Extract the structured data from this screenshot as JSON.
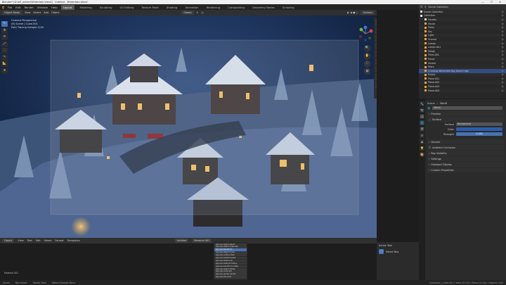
{
  "titlebar": {
    "text": "Blender* [D:\\b3_winter\\Wintertale.blend]  ·  Untitled - Wintertale.blend"
  },
  "menubar": {
    "logo": "⧉",
    "menus": [
      "File",
      "Edit",
      "Render",
      "Window",
      "Help"
    ],
    "workspaces": [
      "Layout",
      "Modeling",
      "Sculpting",
      "UV Editing",
      "Texture Paint",
      "Shading",
      "Animation",
      "Rendering",
      "Compositing",
      "Geometry Nodes",
      "Scripting"
    ],
    "active_workspace": "Layout",
    "scene_label": "Scene",
    "view_layer_label": "View Layer"
  },
  "viewport_header": {
    "mode": "Object Mode",
    "menus": [
      "View",
      "Select",
      "Add",
      "Object"
    ],
    "transform": "Global",
    "options": "Options"
  },
  "viewport_overlay": {
    "camera": "Camera Perspective",
    "scene_path": "(6) Scene | Cube.001",
    "samples": "Path Tracing Sample 2/16"
  },
  "toolbar": {
    "tools": [
      "↖",
      "✥",
      "⟳",
      "⤢",
      "⬚",
      "✎",
      "📐",
      "⊕"
    ]
  },
  "nav_buttons": [
    "🔍",
    "✋",
    "🎥",
    "▦"
  ],
  "outliner": {
    "header": "Scene Collection",
    "rows": [
      {
        "label": "Scene Collection",
        "color": "#e0e0e0",
        "selected": false
      },
      {
        "label": "Collection",
        "color": "#e0e0e0",
        "selected": false
      },
      {
        "label": "Houses",
        "color": "#e0e0e0",
        "selected": false
      },
      {
        "label": "House",
        "color": "#e9a23b",
        "selected": false
      },
      {
        "label": "Trees",
        "color": "#e9a23b",
        "selected": false
      },
      {
        "label": "Sky",
        "color": "#e9a23b",
        "selected": false
      },
      {
        "label": "Light",
        "color": "#e9a23b",
        "selected": false
      },
      {
        "label": "Ground",
        "color": "#e9a23b",
        "selected": false
      },
      {
        "label": "Lamps",
        "color": "#e9a23b",
        "selected": false
      },
      {
        "label": "Lamps.001",
        "color": "#e9a23b",
        "selected": false
      },
      {
        "label": "Sleigh",
        "color": "#e9a23b",
        "selected": false
      },
      {
        "label": "Trees.001",
        "color": "#e9a23b",
        "selected": false
      },
      {
        "label": "Fence",
        "color": "#e9a23b",
        "selected": false
      },
      {
        "label": "Smoke",
        "color": "#e9a23b",
        "selected": false
      },
      {
        "label": "Stars",
        "color": "#e9a23b",
        "selected": false
      },
      {
        "label": "Creating Wintertale Big Dome High",
        "color": "#e9a23b",
        "selected": true
      },
      {
        "label": "Empty",
        "color": "#e9a23b",
        "selected": false
      },
      {
        "label": "Plane.001",
        "color": "#e9a23b",
        "selected": false
      },
      {
        "label": "Plane.002",
        "color": "#e9a23b",
        "selected": false
      },
      {
        "label": "Plane.003",
        "color": "#e9a23b",
        "selected": false
      },
      {
        "label": "Plane.004",
        "color": "#e9a23b",
        "selected": false
      }
    ]
  },
  "properties": {
    "tabs": [
      "🔧",
      "📷",
      "🖼",
      "🌐",
      "🎬",
      "⚙",
      "◉",
      "💡",
      "🎨"
    ],
    "active_tab": 3,
    "header": {
      "scene": "Scene",
      "world": "World"
    },
    "world_name": "World",
    "sections": {
      "preview": "Preview",
      "surface": "Surface",
      "volume": "Volume",
      "ambient_occlusion": "Ambient Occlusion",
      "ray_visibility": "Ray Visibility",
      "settings": "Settings",
      "viewport_display": "Viewport Display",
      "custom_properties": "Custom Properties"
    },
    "surface": {
      "label": "Surface",
      "value": "Background"
    },
    "color": {
      "label": "Color"
    },
    "strength": {
      "label": "Strength",
      "value": "0.100"
    },
    "colors": {
      "color_swatch": "#2a5db0"
    }
  },
  "timeline_header": {
    "menus": [
      "Object",
      "View",
      "Text",
      "Edit",
      "Select",
      "Format",
      "Templates"
    ],
    "file": "Untitled",
    "editor": "Material.001"
  },
  "console": {
    "lines": [
      "bpy.ops.object.select",
      "bpy.ops.object.duplicate",
      "bpy.ops.transform",
      "bpy.ops.object.move",
      "bpy.ops.outliner.item",
      "bpy.ops.view3d.select",
      "bpy.ops.object.join",
      "bpy.ops.mesh.primitive",
      "bpy.ops.transform.rotate",
      "bpy.ops.object.shade",
      "bpy.ops.node.add",
      "bpy.ops.render.render",
      "bpy.ops.wm.save"
    ],
    "highlight_index": 2
  },
  "info_line": "Material.001",
  "active_tool": {
    "title": "Active Tool",
    "tool": "Select Box"
  },
  "statusbar": {
    "items": [
      "Select",
      "Box Select",
      "Rotate View",
      "Object Context Menu",
      "Collection | Cube.001 | Verts 25,120 | Faces 22,014 | Objects 1/94"
    ]
  }
}
